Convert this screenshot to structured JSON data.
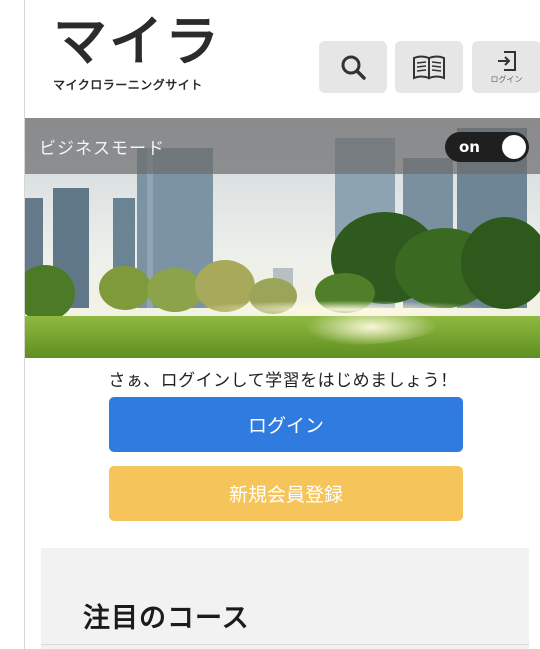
{
  "header": {
    "logo_main": "マイラ",
    "logo_sub": "マイクロラーニングサイト",
    "search_icon": "search-icon",
    "book_icon": "book-icon",
    "login_icon": "login-icon",
    "login_label": "ログイン"
  },
  "business_mode": {
    "label": "ビジネスモード",
    "toggle_text": "on",
    "enabled": true
  },
  "auth": {
    "prompt": "さぁ、ログインして学習をはじめましょう！",
    "login_button": "ログイン",
    "register_button": "新規会員登録"
  },
  "courses": {
    "heading": "注目のコース"
  },
  "colors": {
    "login_blue": "#2f7be0",
    "register_yellow": "#f5c45a",
    "toggle_dark": "#1f1f1f"
  }
}
